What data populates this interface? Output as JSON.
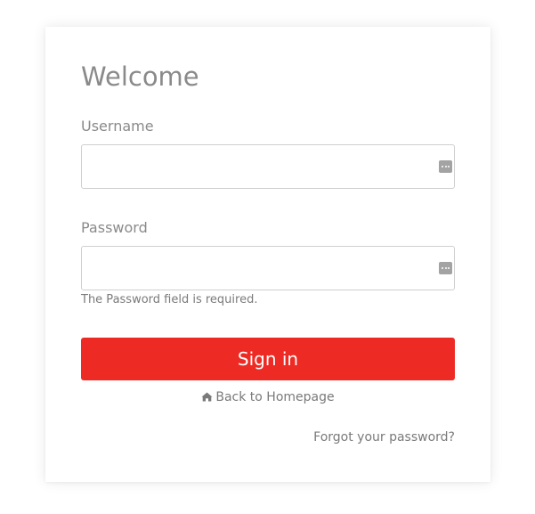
{
  "login": {
    "title": "Welcome",
    "username": {
      "label": "Username",
      "value": "",
      "placeholder": ""
    },
    "password": {
      "label": "Password",
      "value": "",
      "placeholder": "",
      "error": "The Password field is required."
    },
    "sign_in_label": "Sign in",
    "back_link": {
      "icon": "home-icon",
      "label": "Back to Homepage"
    },
    "forgot_password_label": "Forgot your password?"
  },
  "colors": {
    "accent": "#ee2a24",
    "muted_text": "#8a8a8a",
    "border": "#cfcfcf"
  }
}
